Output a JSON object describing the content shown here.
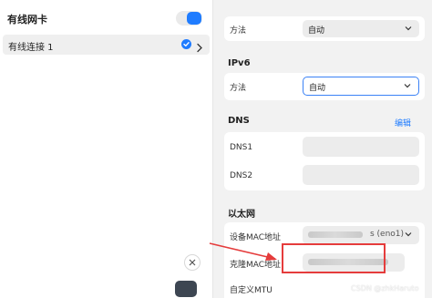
{
  "left": {
    "title": "有线网卡",
    "toggle_on": true,
    "connection": {
      "label": "有线连接 1",
      "selected": true
    }
  },
  "right": {
    "top_method": {
      "label": "方法",
      "value": "自动"
    },
    "ipv6": {
      "title": "IPv6",
      "method": {
        "label": "方法",
        "value": "自动"
      }
    },
    "dns": {
      "title": "DNS",
      "edit": "编辑",
      "dns1": {
        "label": "DNS1",
        "value": ""
      },
      "dns2": {
        "label": "DNS2",
        "value": ""
      }
    },
    "ethernet": {
      "title": "以太网",
      "device_mac": {
        "label": "设备MAC地址",
        "value_suffix": "s (eno1)"
      },
      "clone_mac": {
        "label": "克隆MAC地址"
      },
      "mtu": {
        "label": "自定义MTU"
      }
    }
  },
  "watermark": "CSDN @zhkHaruto",
  "colors": {
    "accent": "#1f7cff",
    "annotation": "#e53c3c"
  },
  "icons": [
    "check-icon",
    "chevron-right-icon",
    "dropdown-arrow-icon",
    "clear-icon",
    "annotation-arrow-icon"
  ]
}
